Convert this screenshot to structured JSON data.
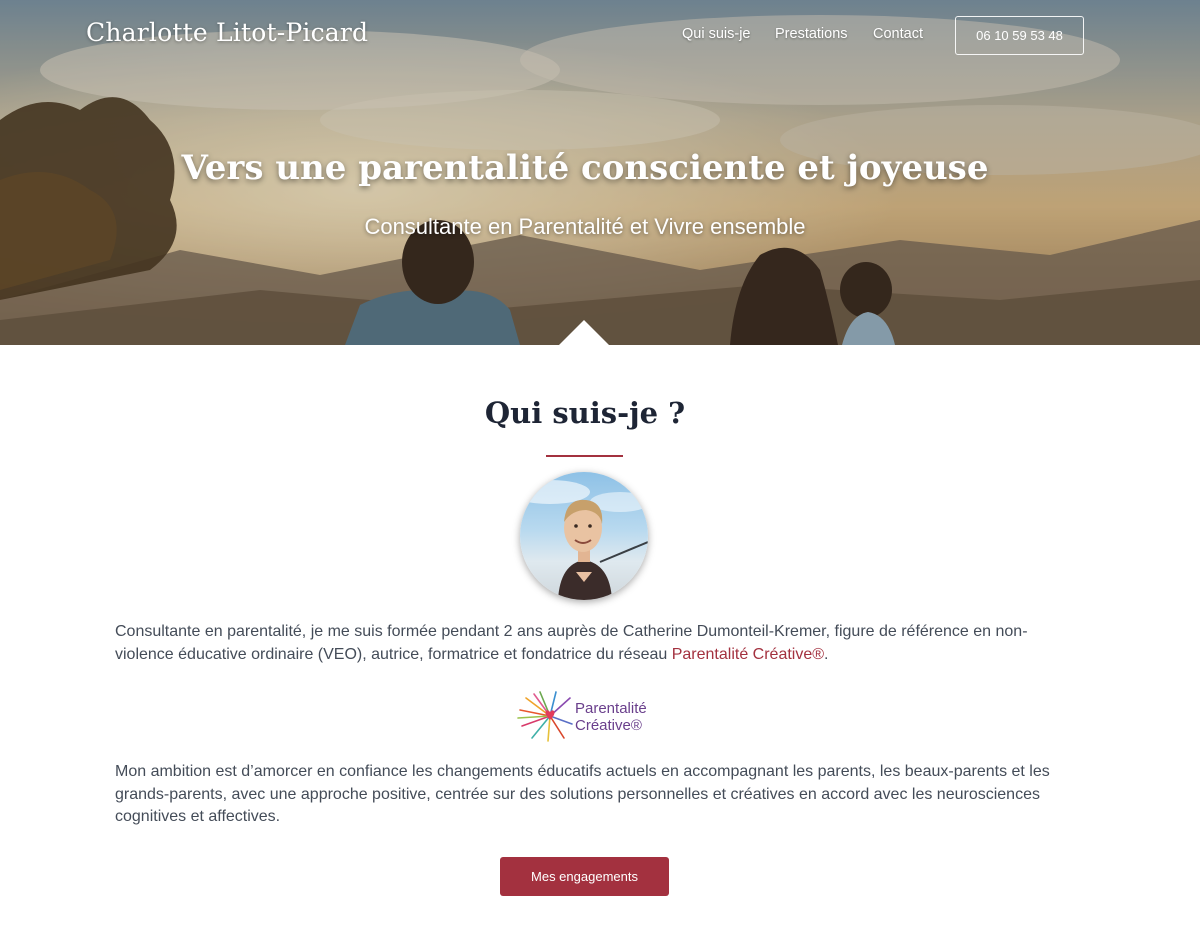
{
  "header": {
    "brand": "Charlotte Litot-Picard",
    "nav": [
      "Qui suis-je",
      "Prestations",
      "Contact"
    ],
    "phone": "06 10 59 53 48"
  },
  "hero": {
    "title": "Vers une parentalité consciente et joyeuse",
    "subtitle": "Consultante en Parentalité et Vivre ensemble"
  },
  "about": {
    "title": "Qui suis-je ?",
    "para1_before": "Consultante en parentalité, je me suis formée pendant 2 ans auprès de Catherine Dumonteil-Kremer, figure de référence en non-violence éducative ordinaire (VEO), autrice, formatrice et fondatrice du réseau ",
    "para1_link": "Parentalité Créative®",
    "para1_after": ".",
    "logo_line1": "Parentalité",
    "logo_line2": "Créative®",
    "para2": "Mon ambition est d’amorcer en confiance les changements éducatifs actuels en accompagnant les parents, les beaux-parents et les grands-parents, avec une approche positive, centrée sur des solutions personnelles et créatives en accord avec les neurosciences cognitives et affectives.",
    "cta": "Mes engagements"
  },
  "colors": {
    "accent": "#a3313f",
    "heading": "#1e2535",
    "text": "#444c58"
  }
}
